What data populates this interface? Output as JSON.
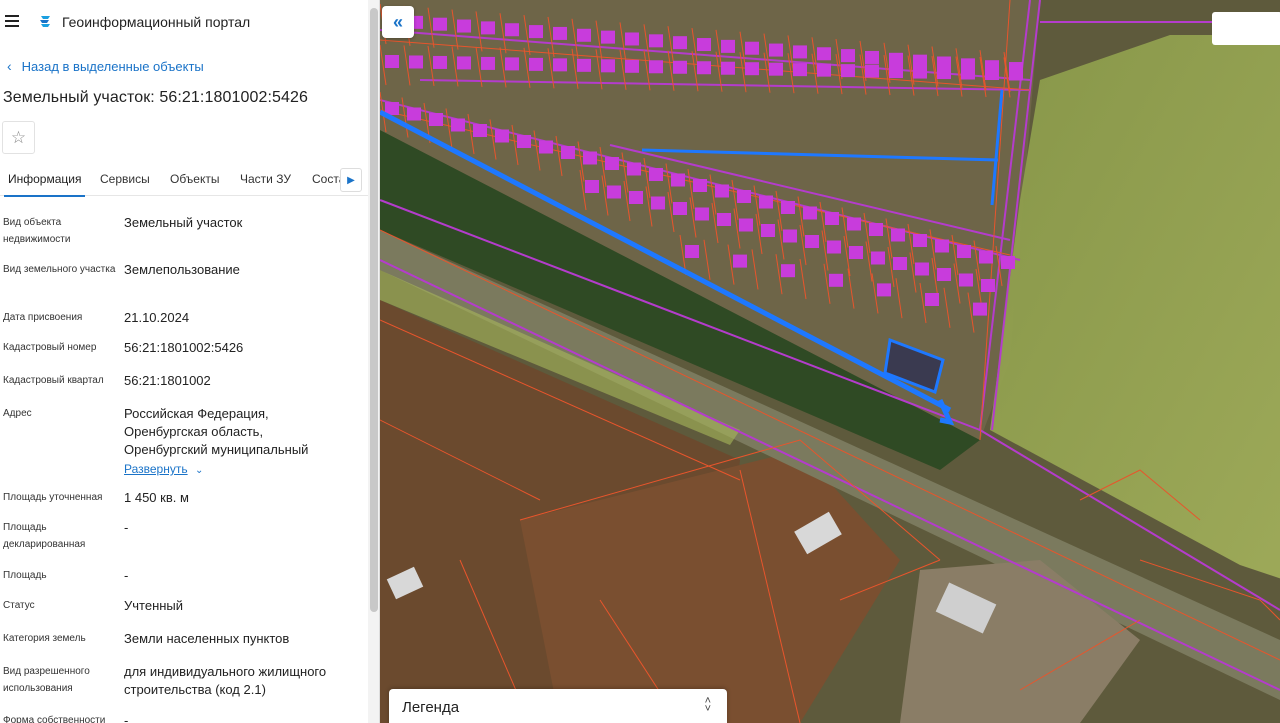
{
  "header": {
    "app_title": "Геоинформационный портал"
  },
  "nav": {
    "back_label": "Назад в выделенные объекты"
  },
  "object": {
    "title": "Земельный участок: 56:21:1801002:5426"
  },
  "tabs": [
    {
      "label": "Информация"
    },
    {
      "label": "Сервисы"
    },
    {
      "label": "Объекты"
    },
    {
      "label": "Части ЗУ"
    },
    {
      "label": "Соста"
    }
  ],
  "fields": [
    {
      "label": "Вид объекта недвижимости",
      "value": "Земельный участок"
    },
    {
      "label": "Вид земельного участка",
      "value": "Землепользование"
    },
    {
      "label": "Дата присвоения",
      "value": "21.10.2024"
    },
    {
      "label": "Кадастровый номер",
      "value": "56:21:1801002:5426"
    },
    {
      "label": "Кадастровый квартал",
      "value": "56:21:1801002"
    },
    {
      "label": "Адрес",
      "value": "Российская Федерация, Оренбургская область, Оренбургский муниципальный"
    },
    {
      "label": "Площадь уточненная",
      "value": "1 450 кв. м"
    },
    {
      "label": "Площадь декларированная",
      "value": "-"
    },
    {
      "label": "Площадь",
      "value": "-"
    },
    {
      "label": "Статус",
      "value": "Учтенный"
    },
    {
      "label": "Категория земель",
      "value": "Земли населенных пунктов"
    },
    {
      "label": "Вид разрешенного использования",
      "value": "для индивидуального жилищного строительства (код 2.1)"
    },
    {
      "label": "Форма собственности",
      "value": "-"
    }
  ],
  "address_expand_label": "Развернуть",
  "map": {
    "legend_label": "Легенда",
    "colors": {
      "parcel_border": "#e8552c",
      "building_fill": "#c83cdc",
      "selection": "#1e78ff",
      "zone_fill": "#b4c84a",
      "road_line": "#b43ccc"
    }
  },
  "icons": {
    "menu": "hamburger-icon",
    "logo": "portal-logo-icon",
    "back": "chevron-left-icon",
    "favorite": "star-icon",
    "tabs_scroll": "chevron-right-icon",
    "collapse": "double-chevron-left-icon",
    "legend_toggle": "unfold-icon"
  }
}
